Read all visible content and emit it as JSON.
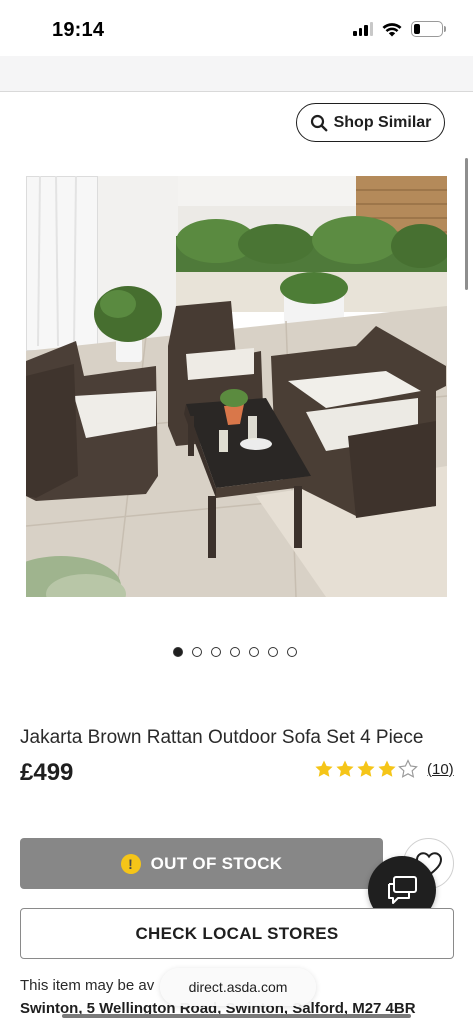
{
  "status_bar": {
    "time": "19:14",
    "icons": [
      "cellular-signal-icon",
      "wifi-icon",
      "battery-icon"
    ],
    "battery_level": 0.22
  },
  "toolbar": {
    "shop_similar_label": "Shop Similar",
    "shop_similar_icon": "search-icon"
  },
  "gallery": {
    "image_count": 7,
    "active_index": 0,
    "image_alt_subject": "rattan outdoor sofa set on patio"
  },
  "product": {
    "title": "Jakarta Brown Rattan Outdoor Sofa Set 4 Piece",
    "price": "£499",
    "rating": 4,
    "rating_max": 5,
    "review_count": "(10)",
    "star_color": "#f5c518"
  },
  "actions": {
    "out_of_stock_label": "OUT OF STOCK",
    "out_of_stock_icon": "warning-icon",
    "wishlist_icon": "heart-icon",
    "chat_icon": "chat-bubbles-icon",
    "check_local_stores_label": "CHECK LOCAL STORES"
  },
  "availability": {
    "text": "This item may be av",
    "store_address": "Swinton, 5 Wellington Road, Swinton, Salford, M27 4BR"
  },
  "browser": {
    "url": "direct.asda.com"
  }
}
